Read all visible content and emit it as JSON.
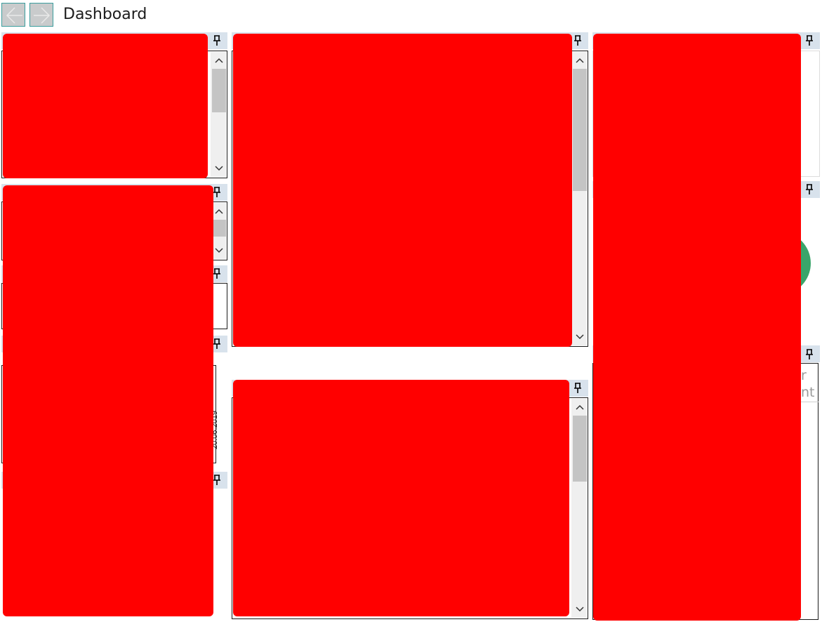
{
  "header": {
    "title": "Dashboard",
    "back_icon": "arrow-left-icon",
    "forward_icon": "arrow-right-icon"
  },
  "panes": {
    "pin_icon": "pin-icon",
    "scroll_up_icon": "chevron-up-icon",
    "scroll_down_icon": "chevron-down-icon"
  },
  "peek_text": {
    "line1": "r",
    "line2": "nt",
    "vertical_date": "20.06.2019"
  },
  "colors": {
    "redaction": "#ff0000",
    "pane_header": "#d8e2ec",
    "nav_border": "#3a9e9e",
    "chart_green": "#3aa56a"
  }
}
